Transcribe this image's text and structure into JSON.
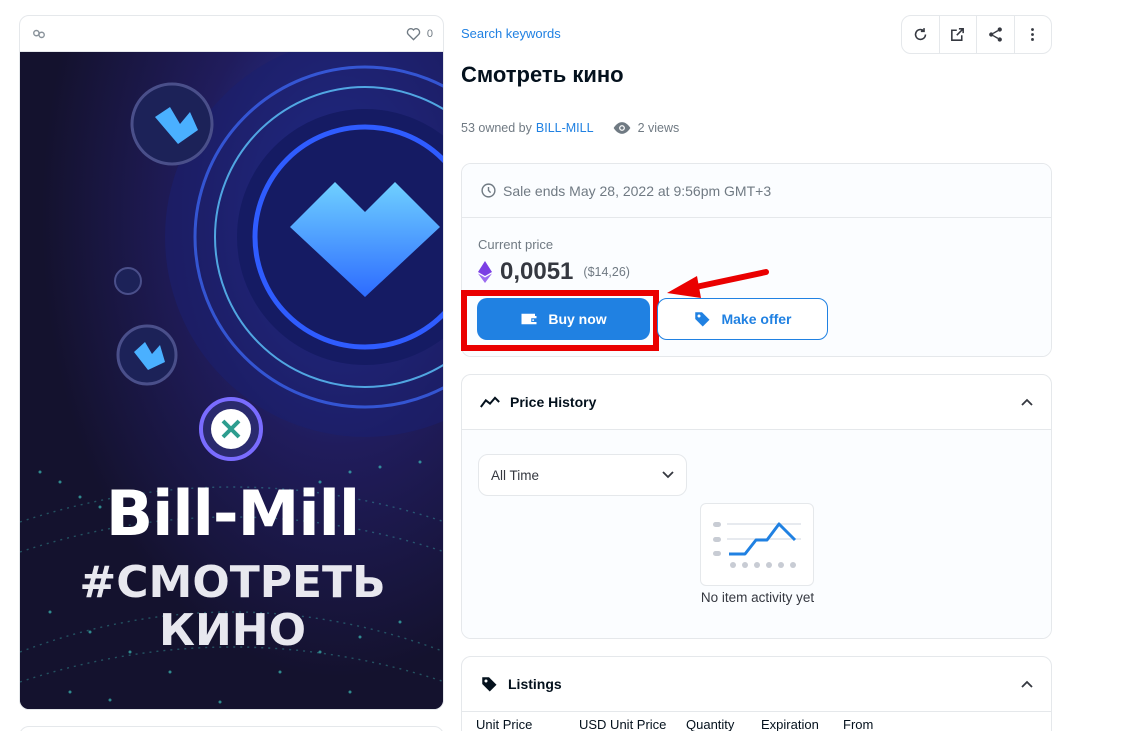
{
  "media": {
    "favorites_count": "0",
    "artwork_title": "Bill-Mill",
    "artwork_subtitle_1": "#СМОТРЕТЬ",
    "artwork_subtitle_2": "КИНО",
    "badge_text": "BILL-MILL"
  },
  "header": {
    "collection_link": "Search keywords",
    "toolbar_icons": [
      "refresh-icon",
      "external-link-icon",
      "share-icon",
      "more-icon"
    ]
  },
  "item": {
    "title": "Смотреть кино",
    "owned_prefix": "53 owned by",
    "owner": "BILL-MILL",
    "views": "2 views"
  },
  "sale": {
    "ends_text": "Sale ends May 28, 2022 at 9:56pm GMT+3",
    "current_price_label": "Current price",
    "price": "0,0051",
    "usd_price": "($14,26)",
    "buy_label": "Buy now",
    "offer_label": "Make offer"
  },
  "price_history": {
    "title": "Price History",
    "range_selected": "All Time",
    "empty_text": "No item activity yet"
  },
  "listings": {
    "title": "Listings",
    "columns": [
      "Unit Price",
      "USD Unit Price",
      "Quantity",
      "Expiration",
      "From"
    ]
  },
  "colors": {
    "accent": "#2081e2",
    "highlight": "#ea0000",
    "eth": "#7b3fe4"
  }
}
